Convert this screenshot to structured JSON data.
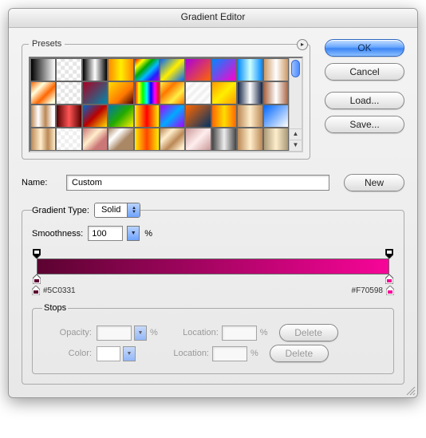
{
  "title": "Gradient Editor",
  "buttons": {
    "ok": "OK",
    "cancel": "Cancel",
    "load": "Load...",
    "save": "Save...",
    "new": "New",
    "delete": "Delete"
  },
  "presets": {
    "legend": "Presets",
    "swatches": [
      "linear-gradient(90deg,#000,#fff)",
      "repeating-conic-gradient(#e5e5e5 0 25%, #fff 0 50%) 50% / 10px 10px",
      "linear-gradient(90deg,#000,#fff 50%,#000)",
      "linear-gradient(90deg,#f80,#fe0 50%,#f80)",
      "linear-gradient(135deg,#e00,#ff0,#0a0,#0bf,#22f,#a0d)",
      "linear-gradient(135deg,#06f,#fe0,#06f)",
      "linear-gradient(135deg,#a0d,#f60)",
      "linear-gradient(135deg,#08f,#f0c)",
      "linear-gradient(90deg,#08f,#cff 50%,#08f)",
      "linear-gradient(90deg,#c96,#fff 50%,#c96)",
      "linear-gradient(135deg,#f60,#ffd 30%,#f60 60%,#ffd 90%)",
      "repeating-conic-gradient(#e5e5e5 0 25%, #fff 0 50%) 50% / 10px 10px",
      "linear-gradient(135deg,#a02,#08a)",
      "linear-gradient(135deg,#fd0,#f70 60%,#400)",
      "linear-gradient(90deg,#f00,#ff0,#0f0,#0ff,#00f,#f0f,#f00)",
      "linear-gradient(135deg,#fe4,#f70,#fe4,#f70)",
      "repeating-linear-gradient(135deg,#eee,#fff 4px,#eee 8px)",
      "linear-gradient(135deg,#f90,#fe0,#f90)",
      "linear-gradient(90deg,#124,#fff 50%,#124)",
      "linear-gradient(90deg,#a64,#fff 50%,#a64)",
      "linear-gradient(90deg,#b85,#fff 30%,#b85 60%,#fff 90%)",
      "linear-gradient(90deg,#500,#f55 50%,#500)",
      "linear-gradient(135deg,#06c,#b00,#fd0)",
      "linear-gradient(135deg,#07a,#2a0,#fe0)",
      "linear-gradient(90deg,#fe0,#f00 50%,#fe0)",
      "linear-gradient(135deg,#a0f,#0af,#a0f)",
      "linear-gradient(135deg,#f60,#036)",
      "linear-gradient(90deg,#f60,#fd0 50%,#f60)",
      "linear-gradient(90deg,#b85,#fec 50%,#b85)",
      "linear-gradient(135deg,#06f,#fff)",
      "linear-gradient(90deg,#b85,#fec 40%,#b85 70%,#fec)",
      "repeating-conic-gradient(#eee 0 25%, #fff 0 50%) 50% / 10px 10px",
      "linear-gradient(135deg,#c77,#fec 40%,#c77 70%)",
      "linear-gradient(135deg,#a86,#fff 30%,#a86 60%)",
      "linear-gradient(90deg,#fe0,#f40 50%,#fe0)",
      "linear-gradient(135deg,#b85,#fec 30%,#b85 60%,#fec 90%)",
      "linear-gradient(135deg,#c99,#fee 50%,#c99)",
      "linear-gradient(90deg,#444,#eee 50%,#444)",
      "linear-gradient(90deg,#b85,#fec 50%,#b85)",
      "linear-gradient(90deg,#a97,#fec 50%,#a97)"
    ]
  },
  "name": {
    "label": "Name:",
    "value": "Custom"
  },
  "gradient_type": {
    "label": "Gradient Type:",
    "value": "Solid",
    "smoothness_label": "Smoothness:",
    "smoothness_value": "100",
    "percent": "%"
  },
  "gradient": {
    "start": "#5C0331",
    "end": "#F70598",
    "css": "linear-gradient(90deg,#5C0331,#F70598)"
  },
  "stops": {
    "legend": "Stops",
    "opacity_label": "Opacity:",
    "color_label": "Color:",
    "location_label": "Location:",
    "opacity_value": "",
    "location1_value": "",
    "location2_value": ""
  }
}
